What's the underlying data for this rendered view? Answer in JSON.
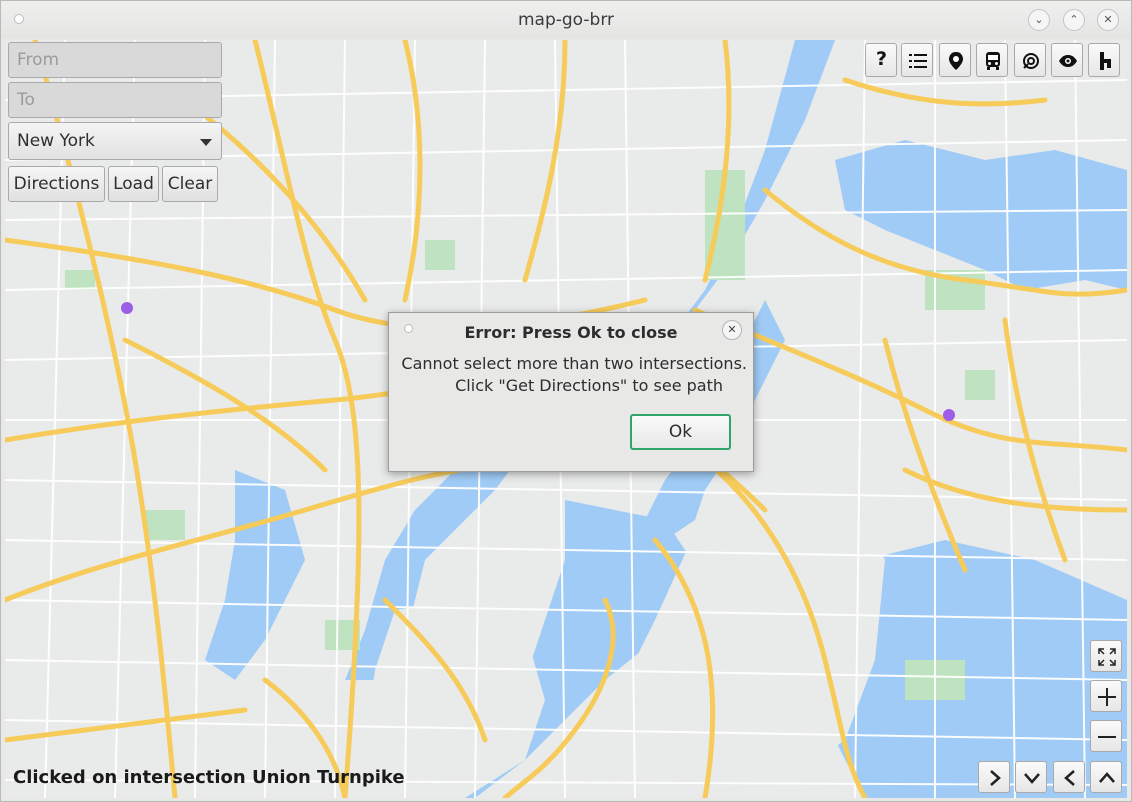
{
  "window": {
    "title": "map-go-brr",
    "controls": [
      "minimize",
      "maximize",
      "close"
    ]
  },
  "search": {
    "from_placeholder": "From",
    "to_placeholder": "To",
    "city_selected": "New York"
  },
  "actions": {
    "directions_label": "Directions",
    "load_label": "Load",
    "clear_label": "Clear"
  },
  "toolbar": {
    "help_label": "?",
    "icons": [
      "help-icon",
      "list-icon",
      "location-pin-icon",
      "transit-icon",
      "layers-icon",
      "eye-icon",
      "pedestrian-icon"
    ]
  },
  "navigation": {
    "icons": [
      "fullscreen-icon",
      "zoom-in-icon",
      "zoom-out-icon",
      "pan-right-icon",
      "pan-down-icon",
      "pan-left-icon",
      "pan-up-icon"
    ]
  },
  "status": {
    "text": "Clicked on intersection Union Turnpike"
  },
  "dialog": {
    "title": "Error: Press Ok to close",
    "line1": "Cannot select more than two intersections.",
    "line2": "Click \"Get Directions\" to see path",
    "ok_label": "Ok"
  },
  "map": {
    "colors": {
      "land": "#e9eaea",
      "water": "#9fcbf6",
      "park": "#bfe3c0",
      "highway": "#f6cb59",
      "street": "#ffffff",
      "marker": "#9d5de6"
    },
    "marker_count": 2
  }
}
